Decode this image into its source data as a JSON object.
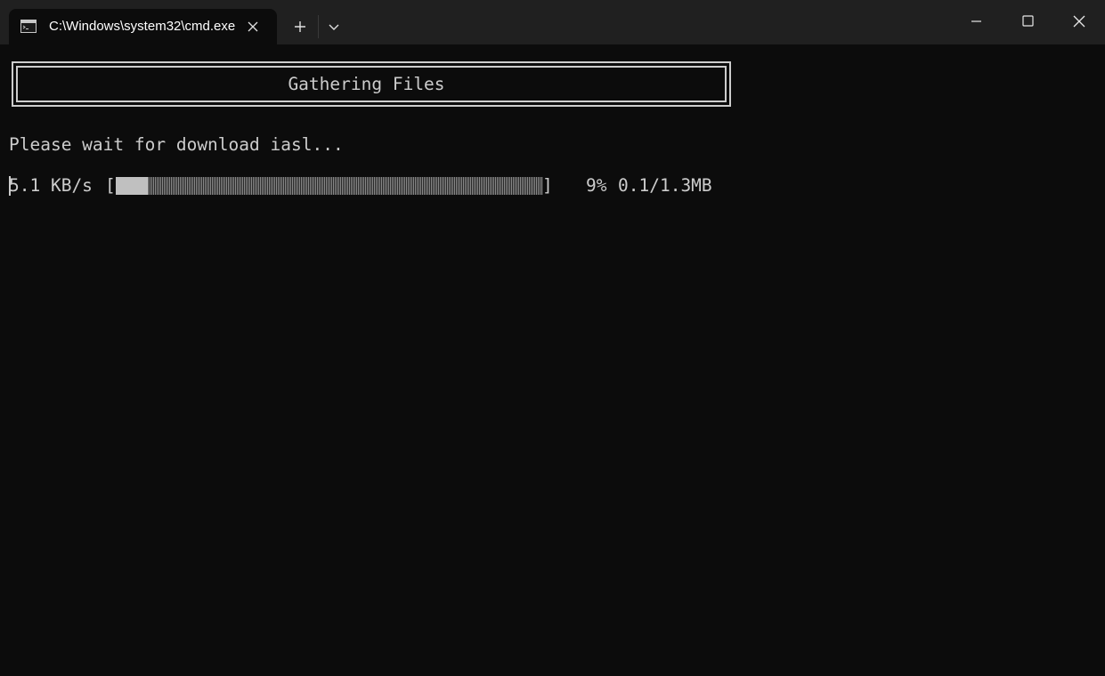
{
  "window": {
    "tab_title": "C:\\Windows\\system32\\cmd.exe",
    "tab_icon": "console-icon",
    "tab_close_icon": "close-icon",
    "new_tab_icon": "plus-icon",
    "dropdown_icon": "chevron-down-icon",
    "minimize_icon": "minimize-icon",
    "maximize_icon": "maximize-icon",
    "close_window_icon": "close-icon"
  },
  "console": {
    "header_title": "Gathering Files",
    "wait_message": "Please wait for download iasl...",
    "progress": {
      "speed": "5.1 KB/s",
      "bracket_open": "[",
      "bracket_close": "]",
      "percent_label": "9%",
      "size": "0.1/1.3MB",
      "fraction": 0.075
    }
  },
  "colors": {
    "titlebar_bg": "#202020",
    "console_bg": "#0c0c0c",
    "console_text": "#cccccc",
    "tab_text": "#ffffff"
  }
}
